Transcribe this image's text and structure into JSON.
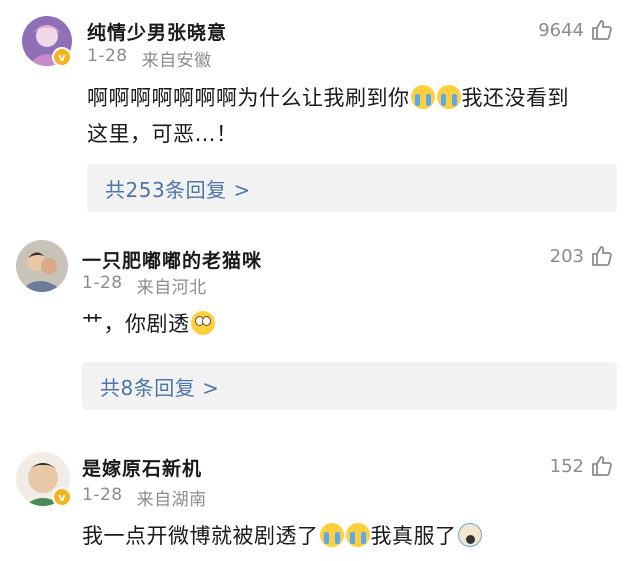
{
  "comments": [
    {
      "username": "纯情少男张晓意",
      "date": "1-28",
      "location": "来自安徽",
      "likes": "9644",
      "text_parts": [
        "啊啊啊啊啊啊啊为什么让我刷到你",
        "我还没看到",
        "这里，可恶…！"
      ],
      "replies": "共253条回复 >"
    },
    {
      "username": "一只肥嘟嘟的老猫咪",
      "date": "1-28",
      "location": "来自河北",
      "likes": "203",
      "text_parts": [
        "艹，你剧透"
      ],
      "replies": "共8条回复 >"
    },
    {
      "username": "是嫁原石新机",
      "date": "1-28",
      "location": "来自湖南",
      "likes": "152",
      "text_parts": [
        "我一点开微博就被剧透了",
        "我真服了"
      ]
    }
  ],
  "icons": {
    "like": "thumbs-up-icon",
    "verified": "verified-badge-icon"
  },
  "colors": {
    "reply_link": "#4d76a6",
    "meta_gray": "#8c8c8c",
    "badge": "#f5b320"
  }
}
